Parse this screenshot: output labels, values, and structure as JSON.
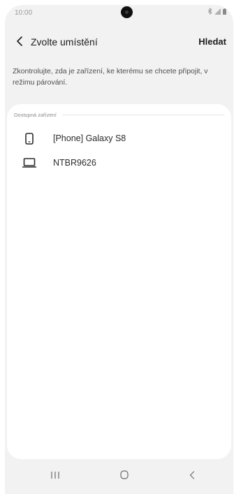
{
  "status_bar": {
    "time": "10:00",
    "icons": [
      "bluetooth-icon",
      "signal-icon",
      "battery-icon"
    ]
  },
  "header": {
    "back_icon": "back-chevron-icon",
    "title": "Zvolte umístění",
    "action_label": "Hledat"
  },
  "instruction_text": "Zkontrolujte, zda je zařízení, ke kterému se chcete připojit, v režimu párování.",
  "available_devices": {
    "section_title": "Dostupná zařízení",
    "items": [
      {
        "icon": "phone-icon",
        "label": "[Phone] Galaxy S8"
      },
      {
        "icon": "laptop-icon",
        "label": "NTBR9626"
      }
    ]
  },
  "nav_bar": {
    "buttons": [
      "recent-apps-icon",
      "home-icon",
      "back-icon"
    ]
  },
  "colors": {
    "background": "#f2f2f2",
    "card": "#ffffff",
    "text_primary": "#1d1d1d",
    "text_secondary": "#8a8a8a"
  }
}
